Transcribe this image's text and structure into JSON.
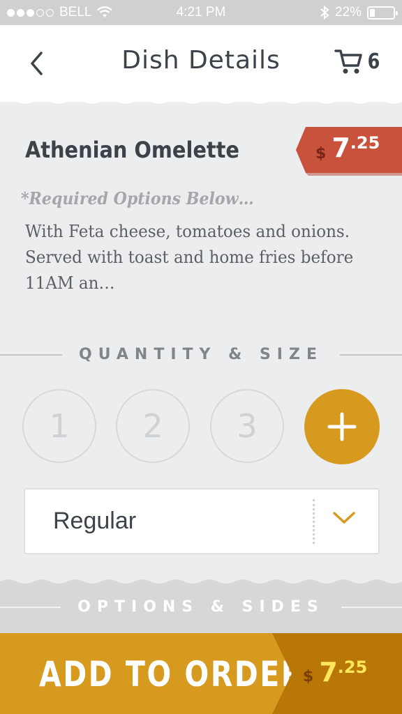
{
  "status_bar": {
    "carrier": "BELL",
    "time": "4:21 PM",
    "battery_percent": "22%",
    "battery_level": 0.22,
    "signal_bars_filled": 3,
    "signal_bars_total": 5,
    "icons": [
      "wifi-icon",
      "bluetooth-icon",
      "battery-icon"
    ]
  },
  "header": {
    "title": "Dish Details",
    "cart_count": "6",
    "icons": [
      "back-chevron-icon",
      "cart-icon"
    ]
  },
  "dish": {
    "name": "Athenian Omelette",
    "price": {
      "currency": "$",
      "dollars": "7",
      "cents": ".25"
    },
    "required_note": "*Required Options Below…",
    "description": "With Feta cheese, tomatoes and onions. Served with toast and home fries before 11AM an…"
  },
  "quantity_section": {
    "label": "QUANTITY & SIZE",
    "options": [
      "1",
      "2",
      "3"
    ],
    "plus_icon": "plus-icon"
  },
  "size_select": {
    "value": "Regular",
    "icon": "chevron-down-icon"
  },
  "options_section": {
    "label": "OPTIONS & SIDES"
  },
  "add_to_order": {
    "label": "ADD TO ORDER",
    "price": {
      "currency": "$",
      "dollars": "7",
      "cents": ".25"
    }
  },
  "colors": {
    "accent": "#d69a1f",
    "price_tag": "#c9523d",
    "text_dark": "#3b4249",
    "background": "#ecedef"
  }
}
